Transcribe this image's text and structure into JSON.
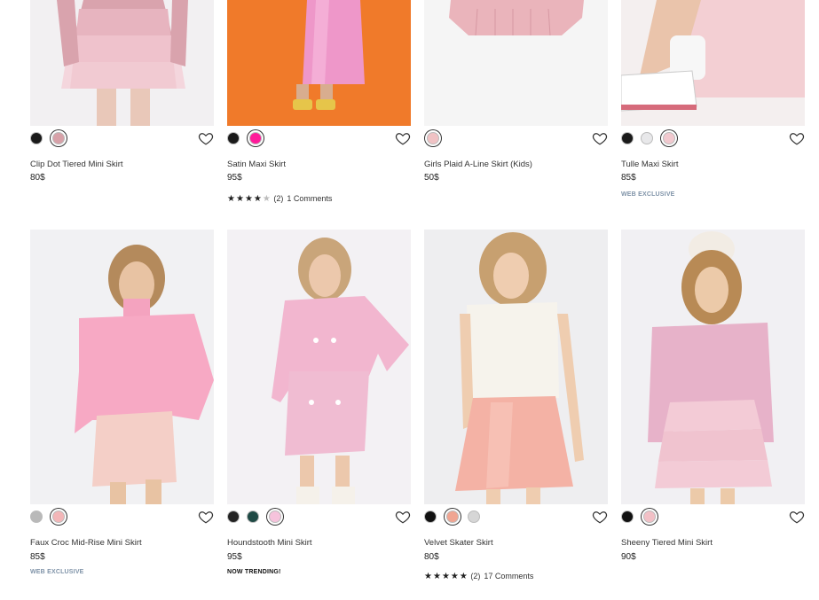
{
  "products": [
    {
      "name": "Clip Dot Tiered Mini Skirt",
      "price": "80$",
      "swatches": [
        "#1a1a1a",
        "#d7a1a8"
      ],
      "selected": 1,
      "badge": "",
      "rating": null,
      "comments": ""
    },
    {
      "name": "Satin Maxi Skirt",
      "price": "95$",
      "swatches": [
        "#1a1a1a",
        "#ff1b9a"
      ],
      "selected": 1,
      "badge": "",
      "rating": {
        "stars": 4,
        "count": "(2)"
      },
      "comments": "1 Comments"
    },
    {
      "name": "Girls Plaid A-Line Skirt (Kids)",
      "price": "50$",
      "swatches": [
        "#f0c2c4"
      ],
      "selected": 0,
      "badge": "",
      "rating": null,
      "comments": ""
    },
    {
      "name": "Tulle Maxi Skirt",
      "price": "85$",
      "swatches": [
        "#1a1a1a",
        "#e8e8ea",
        "#f2c9cf"
      ],
      "selected": 2,
      "badge": "WEB EXCLUSIVE",
      "badge_type": "web",
      "rating": null,
      "comments": ""
    },
    {
      "name": "Faux Croc Mid-Rise Mini Skirt",
      "price": "85$",
      "swatches": [
        "#b9b9b9",
        "#f3b6b8"
      ],
      "selected": 1,
      "badge": "WEB EXCLUSIVE",
      "badge_type": "web",
      "rating": null,
      "comments": ""
    },
    {
      "name": "Houndstooth Mini Skirt",
      "price": "95$",
      "swatches": [
        "#222222",
        "#1f4a45",
        "#f6c3dc"
      ],
      "selected": 2,
      "badge": "NOW TRENDING!",
      "badge_type": "trend",
      "rating": null,
      "comments": ""
    },
    {
      "name": "Velvet Skater Skirt",
      "price": "80$",
      "swatches": [
        "#111111",
        "#f0a592",
        "#d6d6d6"
      ],
      "selected": 1,
      "badge": "",
      "rating": {
        "stars": 5,
        "count": "(2)"
      },
      "comments": "17 Comments"
    },
    {
      "name": "Sheeny Tiered Mini Skirt",
      "price": "90$",
      "swatches": [
        "#111111",
        "#f2c0c6"
      ],
      "selected": 1,
      "badge": "",
      "rating": null,
      "comments": ""
    }
  ],
  "icons": {
    "wishlist": "heart-outline-icon",
    "star": "star-icon"
  }
}
